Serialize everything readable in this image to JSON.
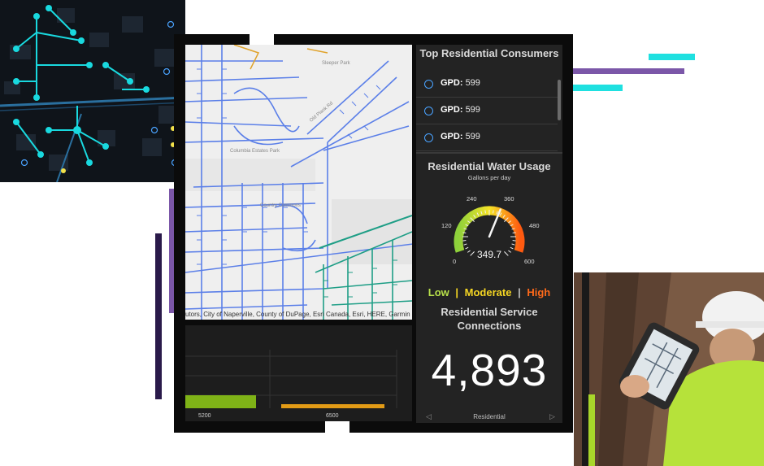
{
  "consumers": {
    "title": "Top Residential Consumers",
    "items": [
      {
        "label": "GPD:",
        "value": "599"
      },
      {
        "label": "GPD:",
        "value": "599"
      },
      {
        "label": "GPD:",
        "value": "599"
      }
    ]
  },
  "usage": {
    "title": "Residential Water Usage",
    "subtitle": "Gallons per day",
    "value": "349.7",
    "value_number": 349.7,
    "min": 0,
    "max": 600,
    "ticks": [
      "0",
      "120",
      "240",
      "360",
      "480",
      "600"
    ]
  },
  "legend": {
    "low": "Low",
    "sep1": "|",
    "moderate": "Moderate",
    "sep2": "|",
    "high": "High",
    "low_color": "#b7e04a",
    "moderate_color": "#f5d623",
    "high_color": "#ff6a1a"
  },
  "connections": {
    "title": "Residential Service Connections",
    "number": "4,893",
    "footer": "Residential"
  },
  "map": {
    "attribution": "utors, City of Naperville, County of DuPage, Esri Canada, Esri, HERE, Garmin",
    "labels": [
      "Sleeper Park",
      "Country Commons",
      "Columbia Estates Park",
      "Old Plank Rd"
    ]
  },
  "chart": {
    "x_ticks": [
      "5200",
      "6500"
    ],
    "bar_colors": [
      "#7fb317",
      "#e29b16"
    ]
  },
  "colors": {
    "accent_cyan": "#1fe0e0",
    "accent_purple": "#7b57a8",
    "pipe_blue": "#5b7fe8",
    "pipe_green": "#1e9e86"
  }
}
